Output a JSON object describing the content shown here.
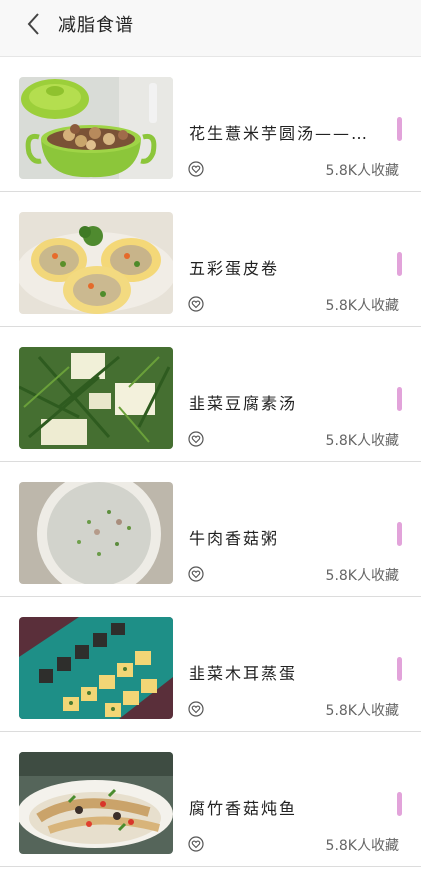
{
  "header": {
    "title": "减脂食谱",
    "back_icon": "chevron-left-icon"
  },
  "accent_color": "#e2a3da",
  "recipes": [
    {
      "name": "花生薏米芋圆汤——…",
      "favorites": "5.8K人收藏",
      "image": "peanut-soup-pot-photo"
    },
    {
      "name": "五彩蛋皮卷",
      "favorites": "5.8K人收藏",
      "image": "egg-roll-photo"
    },
    {
      "name": "韭菜豆腐素汤",
      "favorites": "5.8K人收藏",
      "image": "tofu-soup-photo"
    },
    {
      "name": "牛肉香菇粥",
      "favorites": "5.8K人收藏",
      "image": "beef-porridge-photo"
    },
    {
      "name": "韭菜木耳蒸蛋",
      "favorites": "5.8K人收藏",
      "image": "steamed-egg-photo"
    },
    {
      "name": "腐竹香菇炖鱼",
      "favorites": "5.8K人收藏",
      "image": "fish-stew-photo"
    }
  ]
}
